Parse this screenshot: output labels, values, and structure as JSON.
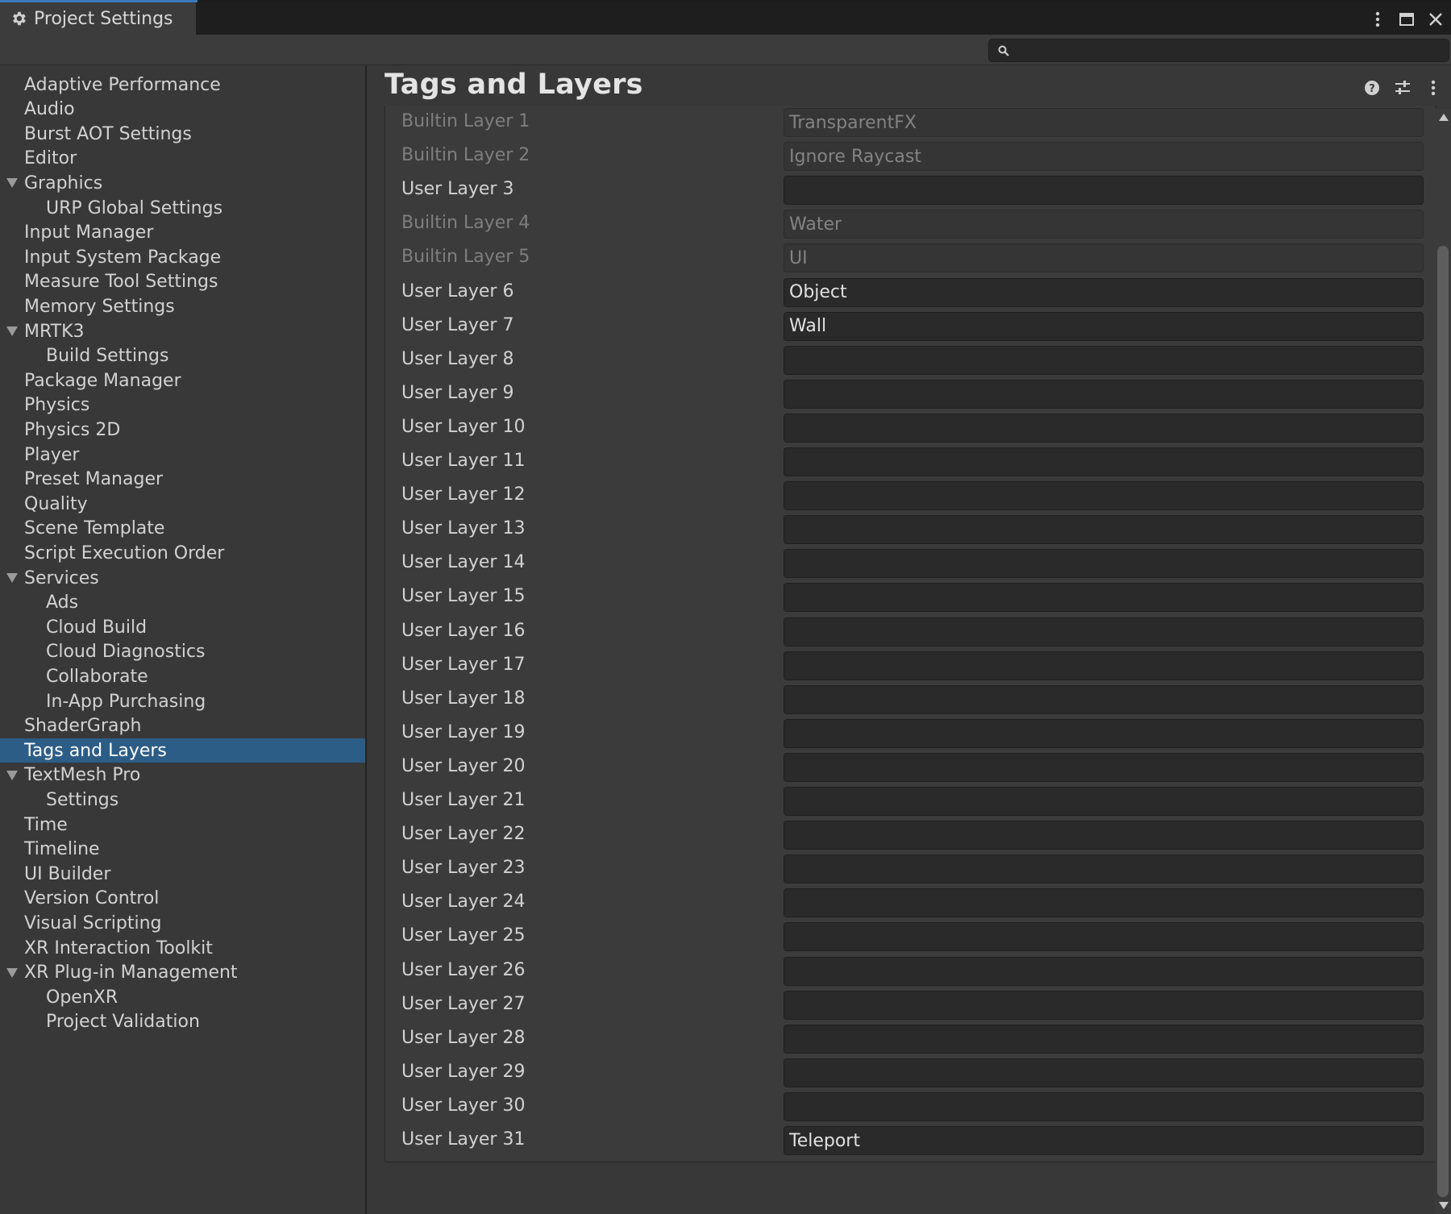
{
  "window": {
    "tab_title": "Project Settings",
    "tab_icon": "gear-icon",
    "controls": [
      "more-options-icon",
      "maximize-icon",
      "close-icon"
    ]
  },
  "search": {
    "placeholder": "",
    "value": ""
  },
  "sidebar": {
    "items": [
      {
        "label": "Adaptive Performance",
        "level": 0,
        "expanded": null,
        "selected": false
      },
      {
        "label": "Audio",
        "level": 0,
        "expanded": null,
        "selected": false
      },
      {
        "label": "Burst AOT Settings",
        "level": 0,
        "expanded": null,
        "selected": false
      },
      {
        "label": "Editor",
        "level": 0,
        "expanded": null,
        "selected": false
      },
      {
        "label": "Graphics",
        "level": 0,
        "expanded": true,
        "selected": false
      },
      {
        "label": "URP Global Settings",
        "level": 1,
        "expanded": null,
        "selected": false
      },
      {
        "label": "Input Manager",
        "level": 0,
        "expanded": null,
        "selected": false
      },
      {
        "label": "Input System Package",
        "level": 0,
        "expanded": null,
        "selected": false
      },
      {
        "label": "Measure Tool Settings",
        "level": 0,
        "expanded": null,
        "selected": false
      },
      {
        "label": "Memory Settings",
        "level": 0,
        "expanded": null,
        "selected": false
      },
      {
        "label": "MRTK3",
        "level": 0,
        "expanded": true,
        "selected": false
      },
      {
        "label": "Build Settings",
        "level": 1,
        "expanded": null,
        "selected": false
      },
      {
        "label": "Package Manager",
        "level": 0,
        "expanded": null,
        "selected": false
      },
      {
        "label": "Physics",
        "level": 0,
        "expanded": null,
        "selected": false
      },
      {
        "label": "Physics 2D",
        "level": 0,
        "expanded": null,
        "selected": false
      },
      {
        "label": "Player",
        "level": 0,
        "expanded": null,
        "selected": false
      },
      {
        "label": "Preset Manager",
        "level": 0,
        "expanded": null,
        "selected": false
      },
      {
        "label": "Quality",
        "level": 0,
        "expanded": null,
        "selected": false
      },
      {
        "label": "Scene Template",
        "level": 0,
        "expanded": null,
        "selected": false
      },
      {
        "label": "Script Execution Order",
        "level": 0,
        "expanded": null,
        "selected": false
      },
      {
        "label": "Services",
        "level": 0,
        "expanded": true,
        "selected": false
      },
      {
        "label": "Ads",
        "level": 1,
        "expanded": null,
        "selected": false
      },
      {
        "label": "Cloud Build",
        "level": 1,
        "expanded": null,
        "selected": false
      },
      {
        "label": "Cloud Diagnostics",
        "level": 1,
        "expanded": null,
        "selected": false
      },
      {
        "label": "Collaborate",
        "level": 1,
        "expanded": null,
        "selected": false
      },
      {
        "label": "In-App Purchasing",
        "level": 1,
        "expanded": null,
        "selected": false
      },
      {
        "label": "ShaderGraph",
        "level": 0,
        "expanded": null,
        "selected": false
      },
      {
        "label": "Tags and Layers",
        "level": 0,
        "expanded": null,
        "selected": true
      },
      {
        "label": "TextMesh Pro",
        "level": 0,
        "expanded": true,
        "selected": false
      },
      {
        "label": "Settings",
        "level": 1,
        "expanded": null,
        "selected": false
      },
      {
        "label": "Time",
        "level": 0,
        "expanded": null,
        "selected": false
      },
      {
        "label": "Timeline",
        "level": 0,
        "expanded": null,
        "selected": false
      },
      {
        "label": "UI Builder",
        "level": 0,
        "expanded": null,
        "selected": false
      },
      {
        "label": "Version Control",
        "level": 0,
        "expanded": null,
        "selected": false
      },
      {
        "label": "Visual Scripting",
        "level": 0,
        "expanded": null,
        "selected": false
      },
      {
        "label": "XR Interaction Toolkit",
        "level": 0,
        "expanded": null,
        "selected": false
      },
      {
        "label": "XR Plug-in Management",
        "level": 0,
        "expanded": true,
        "selected": false
      },
      {
        "label": "OpenXR",
        "level": 1,
        "expanded": null,
        "selected": false
      },
      {
        "label": "Project Validation",
        "level": 1,
        "expanded": null,
        "selected": false
      }
    ]
  },
  "main": {
    "title": "Tags and Layers",
    "header_icons": [
      "help-icon",
      "preset-icon",
      "more-options-icon"
    ],
    "layers": [
      {
        "label": "Builtin Layer 1",
        "value": "TransparentFX",
        "builtin": true
      },
      {
        "label": "Builtin Layer 2",
        "value": "Ignore Raycast",
        "builtin": true
      },
      {
        "label": "User Layer 3",
        "value": "",
        "builtin": false
      },
      {
        "label": "Builtin Layer 4",
        "value": "Water",
        "builtin": true
      },
      {
        "label": "Builtin Layer 5",
        "value": "UI",
        "builtin": true
      },
      {
        "label": "User Layer 6",
        "value": "Object",
        "builtin": false
      },
      {
        "label": "User Layer 7",
        "value": "Wall",
        "builtin": false
      },
      {
        "label": "User Layer 8",
        "value": "",
        "builtin": false
      },
      {
        "label": "User Layer 9",
        "value": "",
        "builtin": false
      },
      {
        "label": "User Layer 10",
        "value": "",
        "builtin": false
      },
      {
        "label": "User Layer 11",
        "value": "",
        "builtin": false
      },
      {
        "label": "User Layer 12",
        "value": "",
        "builtin": false
      },
      {
        "label": "User Layer 13",
        "value": "",
        "builtin": false
      },
      {
        "label": "User Layer 14",
        "value": "",
        "builtin": false
      },
      {
        "label": "User Layer 15",
        "value": "",
        "builtin": false
      },
      {
        "label": "User Layer 16",
        "value": "",
        "builtin": false
      },
      {
        "label": "User Layer 17",
        "value": "",
        "builtin": false
      },
      {
        "label": "User Layer 18",
        "value": "",
        "builtin": false
      },
      {
        "label": "User Layer 19",
        "value": "",
        "builtin": false
      },
      {
        "label": "User Layer 20",
        "value": "",
        "builtin": false
      },
      {
        "label": "User Layer 21",
        "value": "",
        "builtin": false
      },
      {
        "label": "User Layer 22",
        "value": "",
        "builtin": false
      },
      {
        "label": "User Layer 23",
        "value": "",
        "builtin": false
      },
      {
        "label": "User Layer 24",
        "value": "",
        "builtin": false
      },
      {
        "label": "User Layer 25",
        "value": "",
        "builtin": false
      },
      {
        "label": "User Layer 26",
        "value": "",
        "builtin": false
      },
      {
        "label": "User Layer 27",
        "value": "",
        "builtin": false
      },
      {
        "label": "User Layer 28",
        "value": "",
        "builtin": false
      },
      {
        "label": "User Layer 29",
        "value": "",
        "builtin": false
      },
      {
        "label": "User Layer 30",
        "value": "",
        "builtin": false
      },
      {
        "label": "User Layer 31",
        "value": "Teleport",
        "builtin": false
      }
    ]
  },
  "colors": {
    "background": "#383838",
    "selected": "#2c5d87",
    "field": "#2a2a2a",
    "tab_accent": "#3a79bb"
  }
}
